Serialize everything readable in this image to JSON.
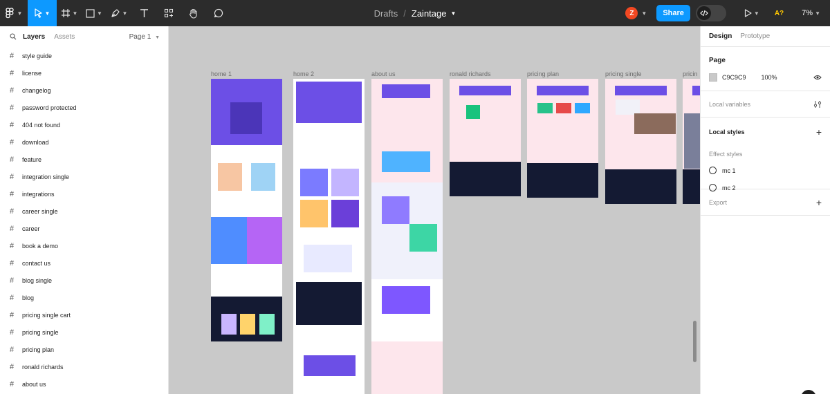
{
  "toolbar": {
    "breadcrumb_drafts": "Drafts",
    "breadcrumb_sep": "/",
    "file_name": "Zaintage",
    "avatar_initial": "Z",
    "share_label": "Share",
    "font_flag": "A?",
    "zoom": "7%"
  },
  "left_panel": {
    "tab_layers": "Layers",
    "tab_assets": "Assets",
    "page_selector": "Page 1",
    "layers": [
      "style guide",
      "license",
      "changelog",
      "password protected",
      "404 not found",
      "download",
      "feature",
      "integration single",
      "integrations",
      "career single",
      "career",
      "book a demo",
      "contact us",
      "blog single",
      "blog",
      "pricing single cart",
      "pricing single",
      "pricing plan",
      "ronald richards",
      "about us"
    ]
  },
  "right_panel": {
    "tab_design": "Design",
    "tab_prototype": "Prototype",
    "page_title": "Page",
    "page_color": "C9C9C9",
    "page_opacity": "100%",
    "local_variables": "Local variables",
    "local_styles": "Local styles",
    "effect_styles": "Effect styles",
    "effects": [
      "mc 1",
      "mc 2"
    ],
    "export": "Export"
  },
  "canvas": {
    "frames": [
      "home 1",
      "home 2",
      "about us",
      "ronald richards",
      "pricing plan",
      "pricing single",
      "pricin"
    ]
  },
  "colors": {
    "toolbar_bg": "#2c2c2c",
    "accent": "#0d99ff",
    "canvas_bg": "#c9c9c9",
    "frame_purple": "#6c4fe6",
    "frame_dark": "#141a33"
  }
}
